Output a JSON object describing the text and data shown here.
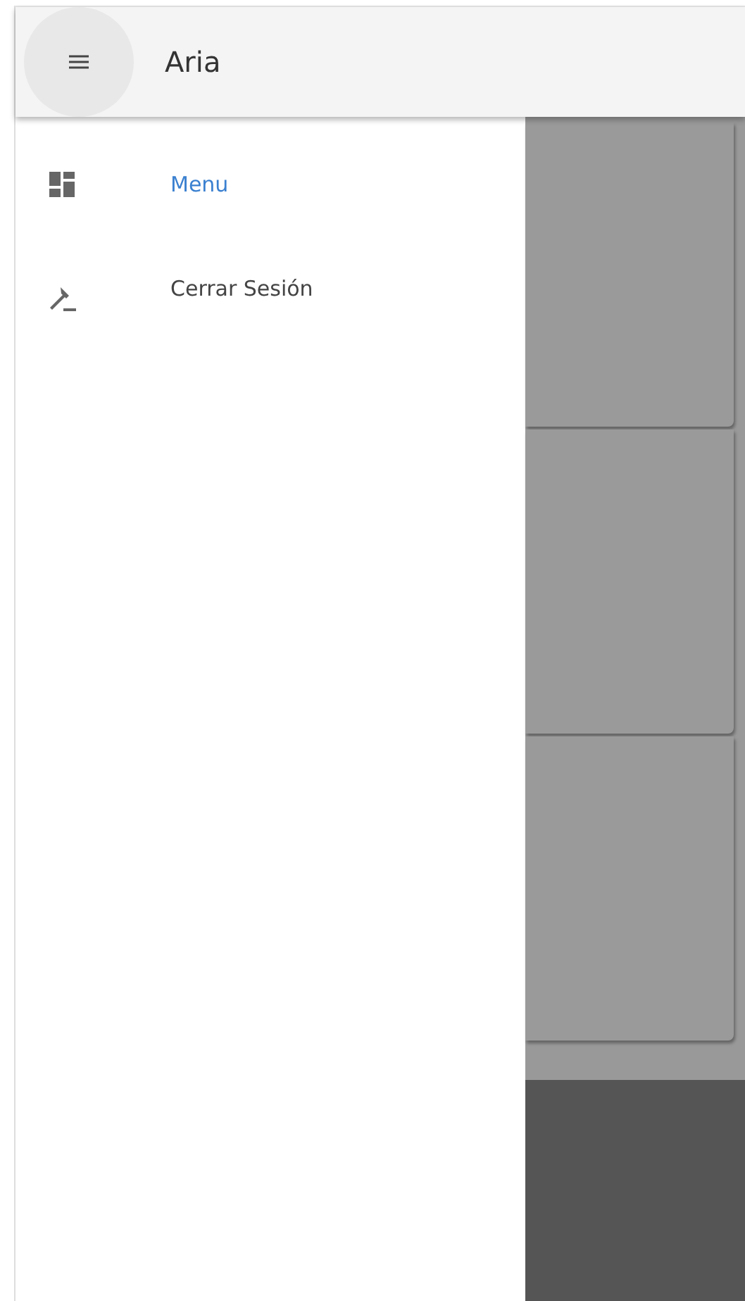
{
  "app_bar": {
    "title": "Aria"
  },
  "drawer": {
    "items": [
      {
        "label": "Menu",
        "kind": "dashboard",
        "selected": true
      },
      {
        "label": "Cerrar Sesión",
        "kind": "gavel",
        "selected": false
      }
    ]
  }
}
